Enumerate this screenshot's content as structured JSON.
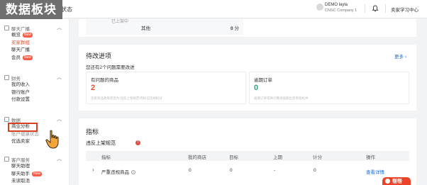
{
  "overlay_title": "数据板块",
  "header": {
    "page_status": "状态",
    "user_name": "DEMO layla",
    "user_company": "CNSC Company 1",
    "seller_center": "卖家学习中心",
    "bell_icon": "bell-icon"
  },
  "sidebar": {
    "sections": [
      {
        "title": "聊天广播",
        "icon": "chat-icon",
        "items": [
          {
            "label": "概览",
            "badge": "New"
          },
          {
            "label": "买家群组",
            "state": "active"
          },
          {
            "label": "聊天广播"
          },
          {
            "label": "会员",
            "badge": "New"
          }
        ]
      },
      {
        "title": "财务",
        "icon": "wallet-icon",
        "items": [
          {
            "label": "我的收入"
          },
          {
            "label": "银行账户"
          },
          {
            "label": "付款设置"
          }
        ]
      },
      {
        "title": "数据",
        "icon": "chart-icon",
        "items": [
          {
            "label": "商业分析",
            "state": "highlighted"
          },
          {
            "label": "账户健康状态"
          },
          {
            "label": "优选卖家"
          }
        ]
      },
      {
        "title": "客户服务",
        "icon": "headset-icon",
        "items": [
          {
            "label": "聊天助理"
          },
          {
            "label": "聊天助手",
            "badge": "New"
          },
          {
            "label": "未读取消"
          }
        ]
      }
    ]
  },
  "top_card": {
    "tile_label": "已上架中",
    "other_label": "其他",
    "other_score": "0",
    "other_unit": "分"
  },
  "todo": {
    "title": "待改进项",
    "more_link": "更多",
    "subtitle": "您还有2个问题需要改进",
    "boxes": [
      {
        "title": "有问题的商品",
        "value": "2",
        "color": "#e0502f",
        "desc": "违反商品政策而因为'违反上架规范'而标记违规扣分"
      },
      {
        "title": "逾期订单",
        "value": "0",
        "color": "#2aa57a",
        "desc": "逾期订单或将计算进逾期出货率指标中"
      }
    ]
  },
  "metrics": {
    "title": "指标",
    "subtitle": "违反上架规范",
    "warn_count": "!",
    "columns": [
      "指标",
      "我的商店",
      "目标",
      "上期",
      "计分",
      "操作"
    ],
    "rows": [
      {
        "metric": "严重违规商品",
        "my_store": "0",
        "target": "0",
        "previous": "-",
        "score": "0",
        "action": "查看详情"
      }
    ]
  },
  "help_widget": {
    "label": "帮帮"
  }
}
